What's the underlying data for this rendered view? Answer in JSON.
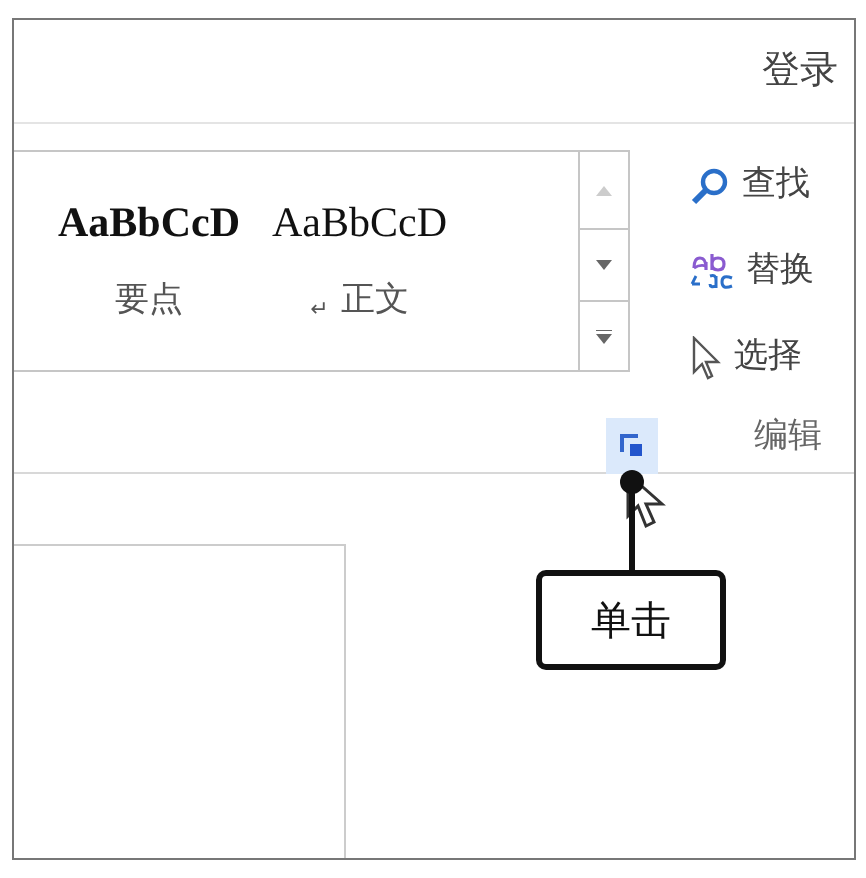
{
  "account": {
    "label": "登录"
  },
  "styles": [
    {
      "sample": "AaBbCcD",
      "bold": true,
      "name": "要点"
    },
    {
      "sample": "AaBbCcD",
      "bold": false,
      "mark": "↵",
      "name": "正文"
    }
  ],
  "editing": {
    "items": [
      {
        "kind": "find",
        "label": "查找"
      },
      {
        "kind": "replace",
        "label": "替换"
      },
      {
        "kind": "select",
        "label": "选择"
      }
    ],
    "group_label": "编辑"
  },
  "callout": {
    "label": "单击"
  }
}
